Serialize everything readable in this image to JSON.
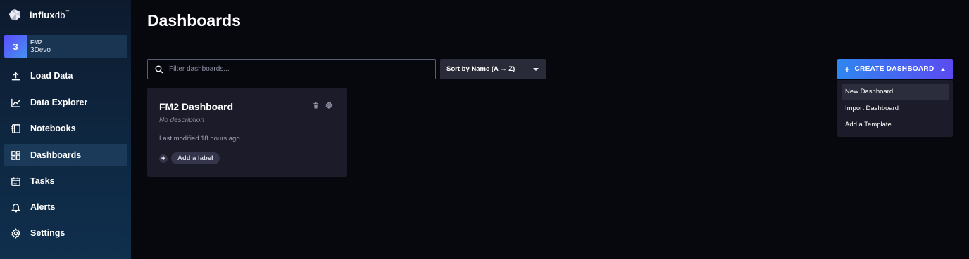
{
  "brand": {
    "name_bold": "influx",
    "name_light": "db",
    "mark": "™"
  },
  "org": {
    "avatar": "3",
    "line1": "FM2",
    "line2": "3Devo"
  },
  "sidebar": {
    "items": [
      {
        "label": "Load Data",
        "icon": "upload-icon"
      },
      {
        "label": "Data Explorer",
        "icon": "graph-icon"
      },
      {
        "label": "Notebooks",
        "icon": "notebook-icon"
      },
      {
        "label": "Dashboards",
        "icon": "dashboards-icon",
        "active": true
      },
      {
        "label": "Tasks",
        "icon": "calendar-icon"
      },
      {
        "label": "Alerts",
        "icon": "bell-icon"
      },
      {
        "label": "Settings",
        "icon": "gear-icon"
      }
    ]
  },
  "main": {
    "title": "Dashboards",
    "filter_placeholder": "Filter dashboards...",
    "sort_label": "Sort by Name (A → Z)",
    "create_label": "CREATE DASHBOARD",
    "create_plus": "+",
    "dropdown": [
      "New Dashboard",
      "Import Dashboard",
      "Add a Template"
    ],
    "card": {
      "title": "FM2 Dashboard",
      "description": "No description",
      "modified": "Last modified 18 hours ago",
      "add_label": "Add a label",
      "plus": "+"
    }
  },
  "colors": {
    "background": "#07070e",
    "sidebar": "#0e2741",
    "card": "#1b1b29",
    "accent_start": "#2f86f0",
    "accent_end": "#5b4bf0"
  }
}
